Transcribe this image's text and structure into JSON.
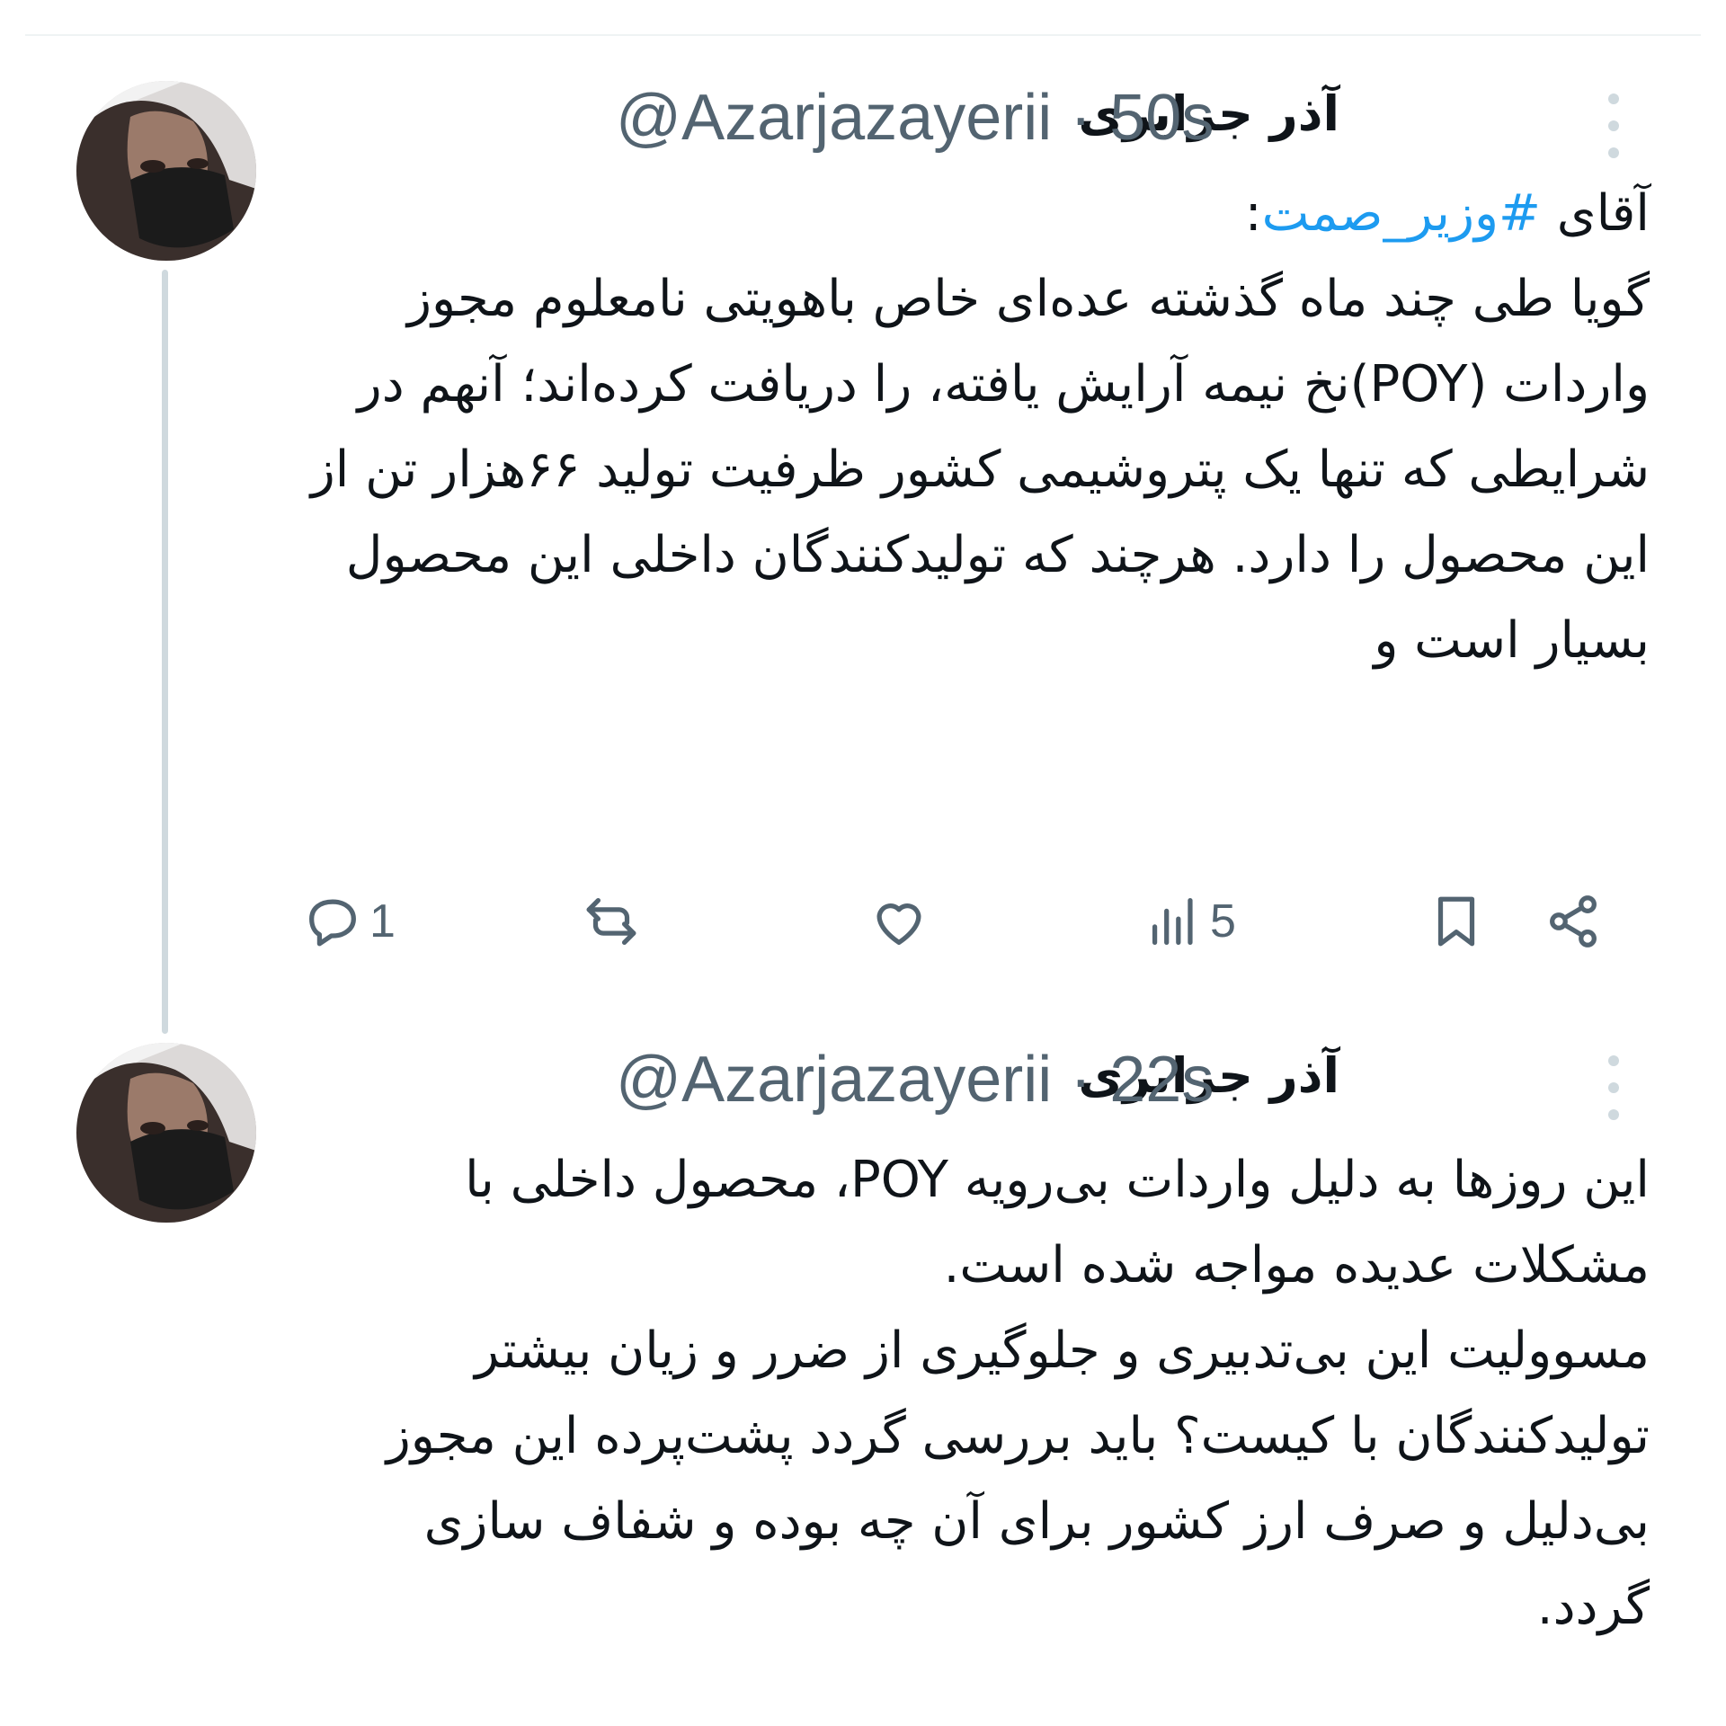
{
  "thread": [
    {
      "display_name": "آذر جزایری",
      "handle": "@Azarjazayerii",
      "separator": "·",
      "time": "50s",
      "text_prefix": "آقای ",
      "hashtag": "#وزیر_صمت",
      "text_suffix": ":",
      "body": "گویا طی چند ماه گذشته عده‌ای خاص باهویتی نامعلوم مجوز واردات (POY)نخ نیمه آرایش یافته، را دریافت کرده‌اند؛ آنهم در شرایطی که تنها یک پتروشیمی کشور ظرفیت تولید ۶۶هزار تن از این محصول را دارد. هرچند که تولیدکنندگان داخلی این محصول بسیار است و",
      "stats": {
        "replies": "1",
        "views": "5"
      }
    },
    {
      "display_name": "آذر جزایری",
      "handle": "@Azarjazayerii",
      "separator": "·",
      "time": "22s",
      "body": "این روزها به دلیل واردات بی‌رویه POY، محصول داخلی با مشکلات عدیده مواجه شده است.\nمسوولیت این بی‌تدبیری و جلوگیری از ضرر و زیان بیشتر تولیدکنندگان با کیست؟ باید بررسی گردد پشت‌پرده این مجوز بی‌دلیل و صرف ارز کشور برای آن چه بوده و شفاف سازی گردد."
    }
  ],
  "icons": {
    "reply": "reply-icon",
    "retweet": "retweet-icon",
    "like": "like-icon",
    "views": "views-icon",
    "bookmark": "bookmark-icon",
    "share": "share-icon",
    "more": "more-icon"
  },
  "colors": {
    "hashtag": "#1d9bf0",
    "muted": "#536471",
    "thread_line": "#cfd9de"
  }
}
